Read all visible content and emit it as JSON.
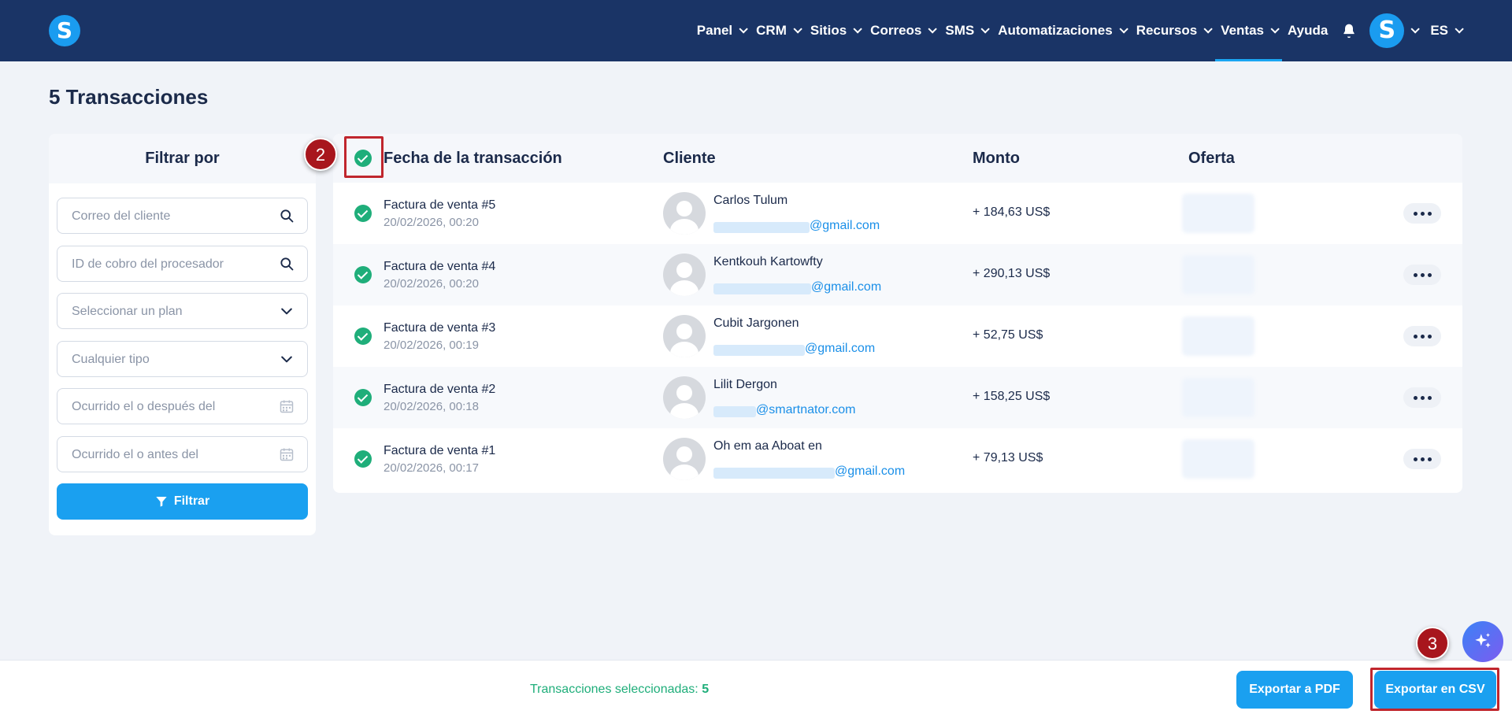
{
  "nav": {
    "logo": "S",
    "items": [
      {
        "label": "Panel",
        "dropdown": true,
        "active": false
      },
      {
        "label": "CRM",
        "dropdown": true,
        "active": false
      },
      {
        "label": "Sitios",
        "dropdown": true,
        "active": false
      },
      {
        "label": "Correos",
        "dropdown": true,
        "active": false
      },
      {
        "label": "SMS",
        "dropdown": true,
        "active": false
      },
      {
        "label": "Automatizaciones",
        "dropdown": true,
        "active": false
      },
      {
        "label": "Recursos",
        "dropdown": true,
        "active": false
      },
      {
        "label": "Ventas",
        "dropdown": true,
        "active": true
      },
      {
        "label": "Ayuda",
        "dropdown": false,
        "active": false
      }
    ],
    "bell_icon": "bell-icon",
    "avatar_letter": "S",
    "language": "ES"
  },
  "page": {
    "title": "5 Transacciones"
  },
  "filters": {
    "heading": "Filtrar por",
    "fields": [
      {
        "placeholder": "Correo del cliente",
        "icon": "search-icon"
      },
      {
        "placeholder": "ID de cobro del procesador",
        "icon": "search-icon"
      },
      {
        "placeholder": "Seleccionar un plan",
        "icon": "chevron-down-icon"
      },
      {
        "placeholder": "Cualquier tipo",
        "icon": "chevron-down-icon"
      },
      {
        "placeholder": "Ocurrido el o después del",
        "icon": "calendar-icon"
      },
      {
        "placeholder": "Ocurrido el o antes del",
        "icon": "calendar-icon"
      }
    ],
    "button": "Filtrar"
  },
  "table": {
    "columns": {
      "date": "Fecha de la transacción",
      "client": "Cliente",
      "amount": "Monto",
      "offer": "Oferta"
    },
    "rows": [
      {
        "title": "Factura de venta #5",
        "date": "20/02/2026, 00:20",
        "name": "Carlos Tulum",
        "email_visible": "@gmail.com",
        "amount": "+ 184,63 US$"
      },
      {
        "title": "Factura de venta #4",
        "date": "20/02/2026, 00:20",
        "name": "Kentkouh Kartowfty",
        "email_visible": "@gmail.com",
        "amount": "+ 290,13 US$"
      },
      {
        "title": "Factura de venta #3",
        "date": "20/02/2026, 00:19",
        "name": "Cubit Jargonen",
        "email_visible": "@gmail.com",
        "amount": "+ 52,75 US$"
      },
      {
        "title": "Factura de venta #2",
        "date": "20/02/2026, 00:18",
        "name": "Lilit Dergon",
        "email_visible": "@smartnator.com",
        "amount": "+ 158,25 US$"
      },
      {
        "title": "Factura de venta #1",
        "date": "20/02/2026, 00:17",
        "name": "Oh em aa Aboat en",
        "email_visible": "@gmail.com",
        "amount": "+ 79,13 US$"
      }
    ]
  },
  "annotations": {
    "step2": "2",
    "step3": "3",
    "color": "#c0262d"
  },
  "bottom": {
    "selected_label": "Transacciones seleccionadas:",
    "selected_count": "5",
    "export_pdf": "Exportar a PDF",
    "export_csv": "Exportar en CSV"
  },
  "colors": {
    "nav_bg": "#1a3466",
    "accent": "#1aa0f0",
    "success": "#1fae7a",
    "link": "#1a8fe8"
  }
}
